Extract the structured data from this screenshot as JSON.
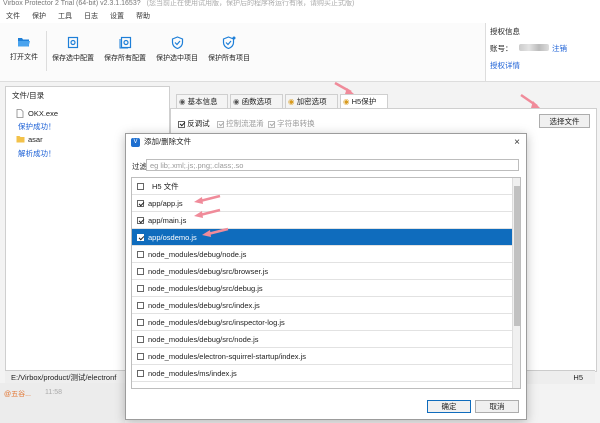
{
  "window": {
    "title": "Virbox Protector 2 Trial (64-bit) v2.3.1.1653?",
    "subtitle": "(您当前正在使用试用版，保护后的程序将运行有限，请购买正式版)"
  },
  "menu": [
    "文件",
    "保护",
    "工具",
    "日志",
    "设置",
    "帮助"
  ],
  "toolbar": {
    "open_file": "打开文件",
    "save_selected_config": "保存选中配置",
    "save_all_config": "保存所有配置",
    "protect_selected": "保护选中项目",
    "protect_all": "保护所有项目"
  },
  "auth": {
    "title": "授权信息",
    "account_label": "账号：",
    "logout": "注销",
    "detail": "授权详情"
  },
  "file_panel": {
    "header": "文件/目录",
    "items": [
      {
        "name": "OKX.exe",
        "status": "保护成功！"
      },
      {
        "name": "asar",
        "status": "解析成功！"
      }
    ]
  },
  "status_bar": {
    "path": "E:/Virbox/product/测试/electronf",
    "right": "H5"
  },
  "tabs": [
    "基本信息",
    "函数选项",
    "加密选项",
    "H5保护"
  ],
  "h5_options": {
    "anti_debug": "反调试",
    "control_flow": "控制流混淆",
    "string_encode": "字符串转换"
  },
  "select_files_button": "选择文件",
  "dialog": {
    "title": "添加/删除文件",
    "filter_label": "过滤",
    "filter_placeholder": "eg lib;.xml;.js;.png;.class;.so",
    "header_row": "H5 文件",
    "files": [
      {
        "path": "app/app.js",
        "checked": true
      },
      {
        "path": "app/main.js",
        "checked": true
      },
      {
        "path": "app/osdemo.js",
        "checked": true
      },
      {
        "path": "node_modules/debug/node.js",
        "checked": false
      },
      {
        "path": "node_modules/debug/src/browser.js",
        "checked": false
      },
      {
        "path": "node_modules/debug/src/debug.js",
        "checked": false
      },
      {
        "path": "node_modules/debug/src/index.js",
        "checked": false
      },
      {
        "path": "node_modules/debug/src/inspector-log.js",
        "checked": false
      },
      {
        "path": "node_modules/debug/src/node.js",
        "checked": false
      },
      {
        "path": "node_modules/electron-squirrel-startup/index.js",
        "checked": false
      },
      {
        "path": "node_modules/ms/index.js",
        "checked": false
      }
    ],
    "ok": "确定",
    "cancel": "取消"
  },
  "background_snippets": {
    "time": "11:58",
    "chat": "@五谷..."
  },
  "colors": {
    "accent": "#0f6cbd",
    "link": "#1a5fd6",
    "annotation_arrow": "#f08b9a"
  }
}
